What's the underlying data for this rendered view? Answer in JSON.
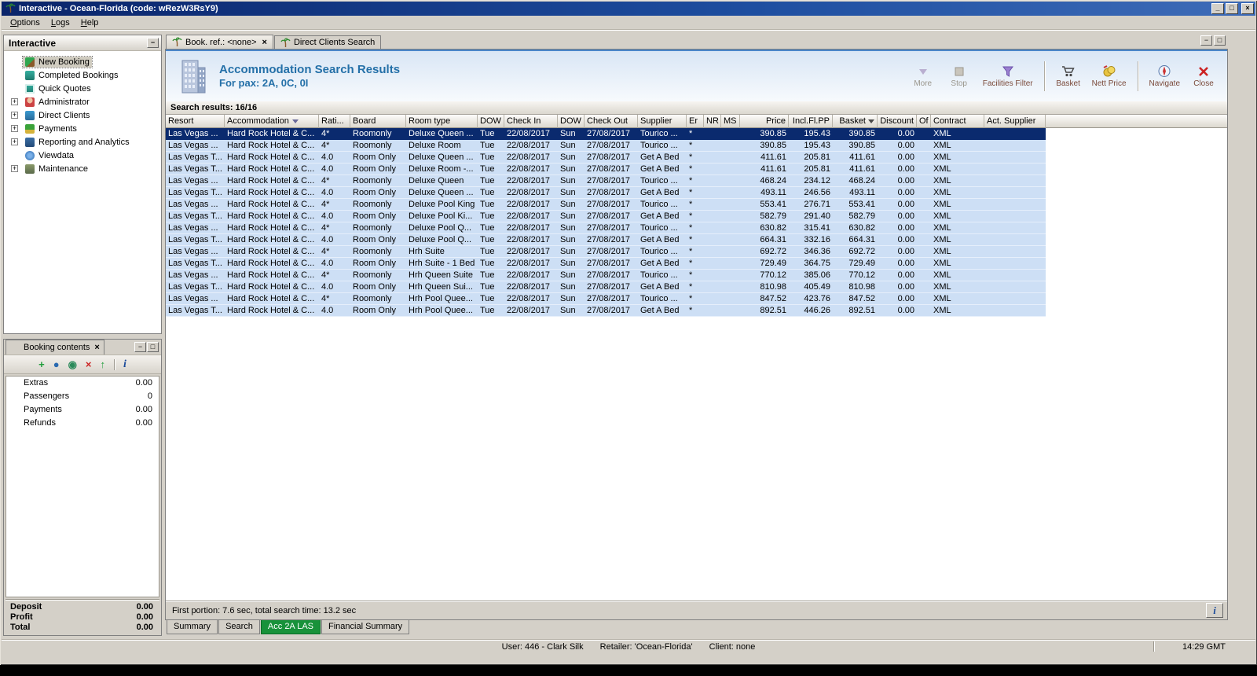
{
  "window": {
    "title": "Interactive - Ocean-Florida (code: wRezW3RsY9)"
  },
  "glyphs": {
    "window_min": "_",
    "window_max": "□",
    "window_close": "×",
    "pane_min": "−",
    "pane_restore": "□",
    "tab_close": "×",
    "expander": "+",
    "info": "i"
  },
  "menubar": {
    "items": [
      "Options",
      "Logs",
      "Help"
    ]
  },
  "sidebar": {
    "title": "Interactive",
    "items": [
      {
        "label": "New Booking",
        "icon": "new-booking-icon",
        "expandable": false,
        "selected": true
      },
      {
        "label": "Completed Bookings",
        "icon": "completed-bookings-icon",
        "expandable": false
      },
      {
        "label": "Quick Quotes",
        "icon": "quick-quotes-icon",
        "expandable": false
      },
      {
        "label": "Administrator",
        "icon": "administrator-icon",
        "expandable": true
      },
      {
        "label": "Direct Clients",
        "icon": "direct-clients-icon",
        "expandable": true
      },
      {
        "label": "Payments",
        "icon": "payments-icon",
        "expandable": true
      },
      {
        "label": "Reporting and Analytics",
        "icon": "reporting-icon",
        "expandable": true
      },
      {
        "label": "Viewdata",
        "icon": "viewdata-icon",
        "expandable": false
      },
      {
        "label": "Maintenance",
        "icon": "maintenance-icon",
        "expandable": true
      }
    ]
  },
  "booking_contents": {
    "title": "Booking contents",
    "toolbar": [
      "add-icon",
      "globe-icon",
      "transfer-icon",
      "delete-icon",
      "move-up-icon",
      "info-icon"
    ],
    "rows": [
      {
        "label": "Extras",
        "value": "0.00"
      },
      {
        "label": "Passengers",
        "value": "0"
      },
      {
        "label": "Payments",
        "value": "0.00"
      },
      {
        "label": "Refunds",
        "value": "0.00"
      }
    ],
    "totals": [
      {
        "label": "Deposit",
        "value": "0.00"
      },
      {
        "label": "Profit",
        "value": "0.00"
      },
      {
        "label": "Total",
        "value": "0.00"
      }
    ]
  },
  "main": {
    "tabs": [
      {
        "label": "Book. ref.: <none>",
        "active": true,
        "closable": true
      },
      {
        "label": "Direct Clients Search",
        "active": false,
        "closable": false
      }
    ],
    "header": {
      "title": "Accommodation Search Results",
      "subtitle": "For pax: 2A, 0C, 0I"
    },
    "toolbar": [
      {
        "label": "More",
        "icon": "more-icon",
        "disabled": true
      },
      {
        "label": "Stop",
        "icon": "stop-icon",
        "disabled": true
      },
      {
        "label": "Facilities Filter",
        "icon": "facilities-filter-icon",
        "disabled": false
      },
      {
        "separator": true
      },
      {
        "label": "Basket",
        "icon": "basket-icon",
        "disabled": false
      },
      {
        "label": "Nett Price",
        "icon": "nett-price-icon",
        "disabled": false
      },
      {
        "separator": true
      },
      {
        "label": "Navigate",
        "icon": "navigate-icon",
        "disabled": false
      },
      {
        "label": "Close",
        "icon": "close-icon",
        "disabled": false
      }
    ],
    "results_label": "Search results: 16/16",
    "status_text": "First portion: 7.6 sec, total search time: 13.2 sec",
    "bottom_tabs": [
      {
        "label": "Summary",
        "active": false
      },
      {
        "label": "Search",
        "active": false
      },
      {
        "label": "Acc 2A LAS",
        "active": true
      },
      {
        "label": "Financial Summary",
        "active": false
      }
    ],
    "table": {
      "selected_index": 0,
      "columns": [
        {
          "label": "Resort"
        },
        {
          "label": "Accommodation",
          "icon": "filter-icon"
        },
        {
          "label": "Rati..."
        },
        {
          "label": "Board"
        },
        {
          "label": "Room type"
        },
        {
          "label": "DOW"
        },
        {
          "label": "Check In"
        },
        {
          "label": "DOW"
        },
        {
          "label": "Check Out"
        },
        {
          "label": "Supplier"
        },
        {
          "label": "Er"
        },
        {
          "label": "NR"
        },
        {
          "label": "MS"
        },
        {
          "label": "Price"
        },
        {
          "label": "Incl.Fl.PP"
        },
        {
          "label": "Basket",
          "icon": "sort-icon"
        },
        {
          "label": "Discount"
        },
        {
          "label": "Of"
        },
        {
          "label": "Contract"
        },
        {
          "label": "Act. Supplier"
        }
      ],
      "rows": [
        [
          "Las Vegas ...",
          "Hard Rock Hotel & C...",
          "4*",
          "Roomonly",
          "Deluxe Queen ...",
          "Tue",
          "22/08/2017",
          "Sun",
          "27/08/2017",
          "Tourico ...",
          "*",
          "",
          "",
          "390.85",
          "195.43",
          "390.85",
          "0.00",
          "",
          "XML",
          ""
        ],
        [
          "Las Vegas ...",
          "Hard Rock Hotel & C...",
          "4*",
          "Roomonly",
          "Deluxe Room",
          "Tue",
          "22/08/2017",
          "Sun",
          "27/08/2017",
          "Tourico ...",
          "*",
          "",
          "",
          "390.85",
          "195.43",
          "390.85",
          "0.00",
          "",
          "XML",
          ""
        ],
        [
          "Las Vegas T...",
          "Hard Rock Hotel & C...",
          "4.0",
          "Room Only",
          "Deluxe Queen ...",
          "Tue",
          "22/08/2017",
          "Sun",
          "27/08/2017",
          "Get A Bed",
          "*",
          "",
          "",
          "411.61",
          "205.81",
          "411.61",
          "0.00",
          "",
          "XML",
          ""
        ],
        [
          "Las Vegas T...",
          "Hard Rock Hotel & C...",
          "4.0",
          "Room Only",
          "Deluxe Room -...",
          "Tue",
          "22/08/2017",
          "Sun",
          "27/08/2017",
          "Get A Bed",
          "*",
          "",
          "",
          "411.61",
          "205.81",
          "411.61",
          "0.00",
          "",
          "XML",
          ""
        ],
        [
          "Las Vegas ...",
          "Hard Rock Hotel & C...",
          "4*",
          "Roomonly",
          "Deluxe Queen",
          "Tue",
          "22/08/2017",
          "Sun",
          "27/08/2017",
          "Tourico ...",
          "*",
          "",
          "",
          "468.24",
          "234.12",
          "468.24",
          "0.00",
          "",
          "XML",
          ""
        ],
        [
          "Las Vegas T...",
          "Hard Rock Hotel & C...",
          "4.0",
          "Room Only",
          "Deluxe Queen ...",
          "Tue",
          "22/08/2017",
          "Sun",
          "27/08/2017",
          "Get A Bed",
          "*",
          "",
          "",
          "493.11",
          "246.56",
          "493.11",
          "0.00",
          "",
          "XML",
          ""
        ],
        [
          "Las Vegas ...",
          "Hard Rock Hotel & C...",
          "4*",
          "Roomonly",
          "Deluxe Pool King",
          "Tue",
          "22/08/2017",
          "Sun",
          "27/08/2017",
          "Tourico ...",
          "*",
          "",
          "",
          "553.41",
          "276.71",
          "553.41",
          "0.00",
          "",
          "XML",
          ""
        ],
        [
          "Las Vegas T...",
          "Hard Rock Hotel & C...",
          "4.0",
          "Room Only",
          "Deluxe Pool Ki...",
          "Tue",
          "22/08/2017",
          "Sun",
          "27/08/2017",
          "Get A Bed",
          "*",
          "",
          "",
          "582.79",
          "291.40",
          "582.79",
          "0.00",
          "",
          "XML",
          ""
        ],
        [
          "Las Vegas ...",
          "Hard Rock Hotel & C...",
          "4*",
          "Roomonly",
          "Deluxe Pool Q...",
          "Tue",
          "22/08/2017",
          "Sun",
          "27/08/2017",
          "Tourico ...",
          "*",
          "",
          "",
          "630.82",
          "315.41",
          "630.82",
          "0.00",
          "",
          "XML",
          ""
        ],
        [
          "Las Vegas T...",
          "Hard Rock Hotel & C...",
          "4.0",
          "Room Only",
          "Deluxe Pool Q...",
          "Tue",
          "22/08/2017",
          "Sun",
          "27/08/2017",
          "Get A Bed",
          "*",
          "",
          "",
          "664.31",
          "332.16",
          "664.31",
          "0.00",
          "",
          "XML",
          ""
        ],
        [
          "Las Vegas ...",
          "Hard Rock Hotel & C...",
          "4*",
          "Roomonly",
          "Hrh Suite",
          "Tue",
          "22/08/2017",
          "Sun",
          "27/08/2017",
          "Tourico ...",
          "*",
          "",
          "",
          "692.72",
          "346.36",
          "692.72",
          "0.00",
          "",
          "XML",
          ""
        ],
        [
          "Las Vegas T...",
          "Hard Rock Hotel & C...",
          "4.0",
          "Room Only",
          "Hrh Suite - 1 Bed",
          "Tue",
          "22/08/2017",
          "Sun",
          "27/08/2017",
          "Get A Bed",
          "*",
          "",
          "",
          "729.49",
          "364.75",
          "729.49",
          "0.00",
          "",
          "XML",
          ""
        ],
        [
          "Las Vegas ...",
          "Hard Rock Hotel & C...",
          "4*",
          "Roomonly",
          "Hrh Queen Suite",
          "Tue",
          "22/08/2017",
          "Sun",
          "27/08/2017",
          "Tourico ...",
          "*",
          "",
          "",
          "770.12",
          "385.06",
          "770.12",
          "0.00",
          "",
          "XML",
          ""
        ],
        [
          "Las Vegas T...",
          "Hard Rock Hotel & C...",
          "4.0",
          "Room Only",
          "Hrh Queen Sui...",
          "Tue",
          "22/08/2017",
          "Sun",
          "27/08/2017",
          "Get A Bed",
          "*",
          "",
          "",
          "810.98",
          "405.49",
          "810.98",
          "0.00",
          "",
          "XML",
          ""
        ],
        [
          "Las Vegas ...",
          "Hard Rock Hotel & C...",
          "4*",
          "Roomonly",
          "Hrh Pool Quee...",
          "Tue",
          "22/08/2017",
          "Sun",
          "27/08/2017",
          "Tourico ...",
          "*",
          "",
          "",
          "847.52",
          "423.76",
          "847.52",
          "0.00",
          "",
          "XML",
          ""
        ],
        [
          "Las Vegas T...",
          "Hard Rock Hotel & C...",
          "4.0",
          "Room Only",
          "Hrh Pool Quee...",
          "Tue",
          "22/08/2017",
          "Sun",
          "27/08/2017",
          "Get A Bed",
          "*",
          "",
          "",
          "892.51",
          "446.26",
          "892.51",
          "0.00",
          "",
          "XML",
          ""
        ]
      ]
    }
  },
  "statusbar": {
    "user": "User: 446 - Clark Silk",
    "retailer": "Retailer: 'Ocean-Florida'",
    "client": "Client: none",
    "time": "14:29 GMT"
  },
  "colors": {
    "titlebar_blue": "#0a246a",
    "row_blue": "#cddff5",
    "selected_row_blue": "#0a2a6e",
    "active_tab_green": "#18923a",
    "header_title_blue": "#2470a8"
  }
}
